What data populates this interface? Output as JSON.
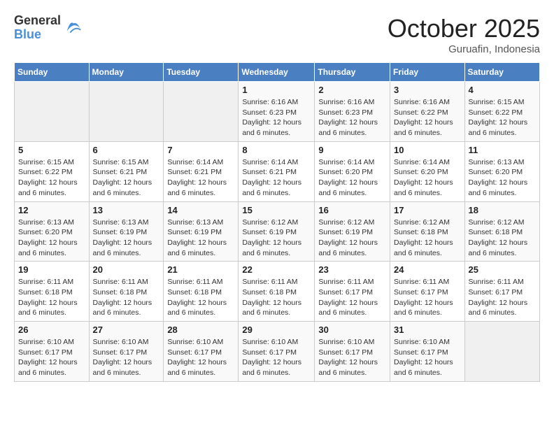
{
  "logo": {
    "general": "General",
    "blue": "Blue"
  },
  "title": "October 2025",
  "subtitle": "Guruafin, Indonesia",
  "days_of_week": [
    "Sunday",
    "Monday",
    "Tuesday",
    "Wednesday",
    "Thursday",
    "Friday",
    "Saturday"
  ],
  "weeks": [
    [
      {
        "day": "",
        "sunrise": "",
        "sunset": "",
        "daylight": ""
      },
      {
        "day": "",
        "sunrise": "",
        "sunset": "",
        "daylight": ""
      },
      {
        "day": "",
        "sunrise": "",
        "sunset": "",
        "daylight": ""
      },
      {
        "day": "1",
        "sunrise": "Sunrise: 6:16 AM",
        "sunset": "Sunset: 6:23 PM",
        "daylight": "Daylight: 12 hours and 6 minutes."
      },
      {
        "day": "2",
        "sunrise": "Sunrise: 6:16 AM",
        "sunset": "Sunset: 6:23 PM",
        "daylight": "Daylight: 12 hours and 6 minutes."
      },
      {
        "day": "3",
        "sunrise": "Sunrise: 6:16 AM",
        "sunset": "Sunset: 6:22 PM",
        "daylight": "Daylight: 12 hours and 6 minutes."
      },
      {
        "day": "4",
        "sunrise": "Sunrise: 6:15 AM",
        "sunset": "Sunset: 6:22 PM",
        "daylight": "Daylight: 12 hours and 6 minutes."
      }
    ],
    [
      {
        "day": "5",
        "sunrise": "Sunrise: 6:15 AM",
        "sunset": "Sunset: 6:22 PM",
        "daylight": "Daylight: 12 hours and 6 minutes."
      },
      {
        "day": "6",
        "sunrise": "Sunrise: 6:15 AM",
        "sunset": "Sunset: 6:21 PM",
        "daylight": "Daylight: 12 hours and 6 minutes."
      },
      {
        "day": "7",
        "sunrise": "Sunrise: 6:14 AM",
        "sunset": "Sunset: 6:21 PM",
        "daylight": "Daylight: 12 hours and 6 minutes."
      },
      {
        "day": "8",
        "sunrise": "Sunrise: 6:14 AM",
        "sunset": "Sunset: 6:21 PM",
        "daylight": "Daylight: 12 hours and 6 minutes."
      },
      {
        "day": "9",
        "sunrise": "Sunrise: 6:14 AM",
        "sunset": "Sunset: 6:20 PM",
        "daylight": "Daylight: 12 hours and 6 minutes."
      },
      {
        "day": "10",
        "sunrise": "Sunrise: 6:14 AM",
        "sunset": "Sunset: 6:20 PM",
        "daylight": "Daylight: 12 hours and 6 minutes."
      },
      {
        "day": "11",
        "sunrise": "Sunrise: 6:13 AM",
        "sunset": "Sunset: 6:20 PM",
        "daylight": "Daylight: 12 hours and 6 minutes."
      }
    ],
    [
      {
        "day": "12",
        "sunrise": "Sunrise: 6:13 AM",
        "sunset": "Sunset: 6:20 PM",
        "daylight": "Daylight: 12 hours and 6 minutes."
      },
      {
        "day": "13",
        "sunrise": "Sunrise: 6:13 AM",
        "sunset": "Sunset: 6:19 PM",
        "daylight": "Daylight: 12 hours and 6 minutes."
      },
      {
        "day": "14",
        "sunrise": "Sunrise: 6:13 AM",
        "sunset": "Sunset: 6:19 PM",
        "daylight": "Daylight: 12 hours and 6 minutes."
      },
      {
        "day": "15",
        "sunrise": "Sunrise: 6:12 AM",
        "sunset": "Sunset: 6:19 PM",
        "daylight": "Daylight: 12 hours and 6 minutes."
      },
      {
        "day": "16",
        "sunrise": "Sunrise: 6:12 AM",
        "sunset": "Sunset: 6:19 PM",
        "daylight": "Daylight: 12 hours and 6 minutes."
      },
      {
        "day": "17",
        "sunrise": "Sunrise: 6:12 AM",
        "sunset": "Sunset: 6:18 PM",
        "daylight": "Daylight: 12 hours and 6 minutes."
      },
      {
        "day": "18",
        "sunrise": "Sunrise: 6:12 AM",
        "sunset": "Sunset: 6:18 PM",
        "daylight": "Daylight: 12 hours and 6 minutes."
      }
    ],
    [
      {
        "day": "19",
        "sunrise": "Sunrise: 6:11 AM",
        "sunset": "Sunset: 6:18 PM",
        "daylight": "Daylight: 12 hours and 6 minutes."
      },
      {
        "day": "20",
        "sunrise": "Sunrise: 6:11 AM",
        "sunset": "Sunset: 6:18 PM",
        "daylight": "Daylight: 12 hours and 6 minutes."
      },
      {
        "day": "21",
        "sunrise": "Sunrise: 6:11 AM",
        "sunset": "Sunset: 6:18 PM",
        "daylight": "Daylight: 12 hours and 6 minutes."
      },
      {
        "day": "22",
        "sunrise": "Sunrise: 6:11 AM",
        "sunset": "Sunset: 6:18 PM",
        "daylight": "Daylight: 12 hours and 6 minutes."
      },
      {
        "day": "23",
        "sunrise": "Sunrise: 6:11 AM",
        "sunset": "Sunset: 6:17 PM",
        "daylight": "Daylight: 12 hours and 6 minutes."
      },
      {
        "day": "24",
        "sunrise": "Sunrise: 6:11 AM",
        "sunset": "Sunset: 6:17 PM",
        "daylight": "Daylight: 12 hours and 6 minutes."
      },
      {
        "day": "25",
        "sunrise": "Sunrise: 6:11 AM",
        "sunset": "Sunset: 6:17 PM",
        "daylight": "Daylight: 12 hours and 6 minutes."
      }
    ],
    [
      {
        "day": "26",
        "sunrise": "Sunrise: 6:10 AM",
        "sunset": "Sunset: 6:17 PM",
        "daylight": "Daylight: 12 hours and 6 minutes."
      },
      {
        "day": "27",
        "sunrise": "Sunrise: 6:10 AM",
        "sunset": "Sunset: 6:17 PM",
        "daylight": "Daylight: 12 hours and 6 minutes."
      },
      {
        "day": "28",
        "sunrise": "Sunrise: 6:10 AM",
        "sunset": "Sunset: 6:17 PM",
        "daylight": "Daylight: 12 hours and 6 minutes."
      },
      {
        "day": "29",
        "sunrise": "Sunrise: 6:10 AM",
        "sunset": "Sunset: 6:17 PM",
        "daylight": "Daylight: 12 hours and 6 minutes."
      },
      {
        "day": "30",
        "sunrise": "Sunrise: 6:10 AM",
        "sunset": "Sunset: 6:17 PM",
        "daylight": "Daylight: 12 hours and 6 minutes."
      },
      {
        "day": "31",
        "sunrise": "Sunrise: 6:10 AM",
        "sunset": "Sunset: 6:17 PM",
        "daylight": "Daylight: 12 hours and 6 minutes."
      },
      {
        "day": "",
        "sunrise": "",
        "sunset": "",
        "daylight": ""
      }
    ]
  ]
}
